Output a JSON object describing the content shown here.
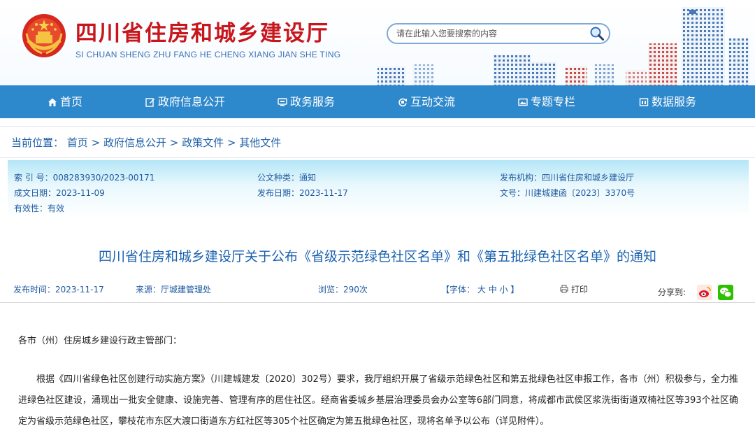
{
  "header": {
    "title": "四川省住房和城乡建设厅",
    "pinyin": "SI CHUAN SHENG ZHU FANG HE CHENG XIANG JIAN SHE TING",
    "search_placeholder": "请在此输入您要搜索的内容"
  },
  "nav": {
    "items": [
      {
        "label": "首页",
        "icon": "home-icon"
      },
      {
        "label": "政府信息公开",
        "icon": "edit-icon"
      },
      {
        "label": "政务服务",
        "icon": "monitor-icon"
      },
      {
        "label": "互动交流",
        "icon": "refresh-icon"
      },
      {
        "label": "专题专栏",
        "icon": "image-icon"
      },
      {
        "label": "数据服务",
        "icon": "database-icon"
      }
    ]
  },
  "breadcrumb": {
    "prefix": "当前位置：",
    "items": [
      "首页",
      "政府信息公开",
      "政策文件",
      "其他文件"
    ],
    "sep": ">"
  },
  "meta": {
    "index_no": "索 引 号：008283930/2023-00171",
    "doc_type": "公文种类：通知",
    "publisher": "发布机构：四川省住房和城乡建设厅",
    "created": "成文日期：2023-11-09",
    "published": "发布日期：2023-11-17",
    "doc_no": "文号：川建城建函〔2023〕3370号",
    "validity": "有效性：有效"
  },
  "doc": {
    "title": "四川省住房和城乡建设厅关于公布《省级示范绿色社区名单》和《第五批绿色社区名单》的通知",
    "publish_time": "发布时间：2023-11-17",
    "source": "来源：厅城建管理处",
    "views": "浏览：290次",
    "font_prefix": "【字体：",
    "font_large": "大",
    "font_medium": "中",
    "font_small": "小",
    "font_suffix": "】",
    "print": "打印",
    "share": "分享到:",
    "greeting": "各市（州）住房城乡建设行政主管部门：",
    "paragraph": "根据《四川省绿色社区创建行动实施方案》（川建城建发〔2020〕302号）要求，我厅组织开展了省级示范绿色社区和第五批绿色社区申报工作，各市（州）积极参与，全力推进绿色社区建设，涌现出一批安全健康、设施完善、管理有序的居住社区。经商省委城乡基层治理委员会办公室等6部门同意，将成都市武侯区浆洗街街道双楠社区等393个社区确定为省级示范绿色社区，攀枝花市东区大渡口街道东方红社区等305个社区确定为第五批绿色社区，现将名单予以公布（详见附件）。"
  },
  "colors": {
    "brand_red": "#c8161d",
    "nav_blue": "#2e88cc",
    "link_blue": "#1e5aa0"
  }
}
